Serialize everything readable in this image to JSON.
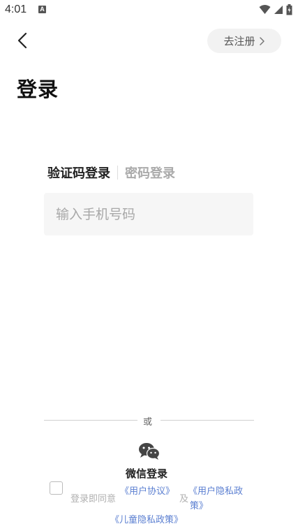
{
  "status_bar": {
    "time": "4:01",
    "notification_badge": "A",
    "icons": [
      "wifi-icon",
      "signal-icon",
      "battery-icon"
    ]
  },
  "header": {
    "back_icon": "chevron-left-icon",
    "register_label": "去注册",
    "register_icon": "chevron-right-icon"
  },
  "page": {
    "title": "登录"
  },
  "tabs": [
    {
      "label": "验证码登录",
      "active": true
    },
    {
      "label": "密码登录",
      "active": false
    }
  ],
  "phone": {
    "value": "",
    "placeholder": "输入手机号码"
  },
  "alt_login": {
    "or_label": "或",
    "wechat_label": "微信登录",
    "wechat_icon": "wechat-icon"
  },
  "agreement": {
    "checked": false,
    "prefix": "登录即同意",
    "user_agreement": "《用户协议》",
    "and": "及",
    "privacy_policy_line1": "《用户隐私政",
    "privacy_policy_line2": "策》",
    "children_policy": "《儿童隐私政策》"
  },
  "colors": {
    "link": "#5b7fd1",
    "background": "#ffffff",
    "input_bg": "#f6f6f6"
  }
}
